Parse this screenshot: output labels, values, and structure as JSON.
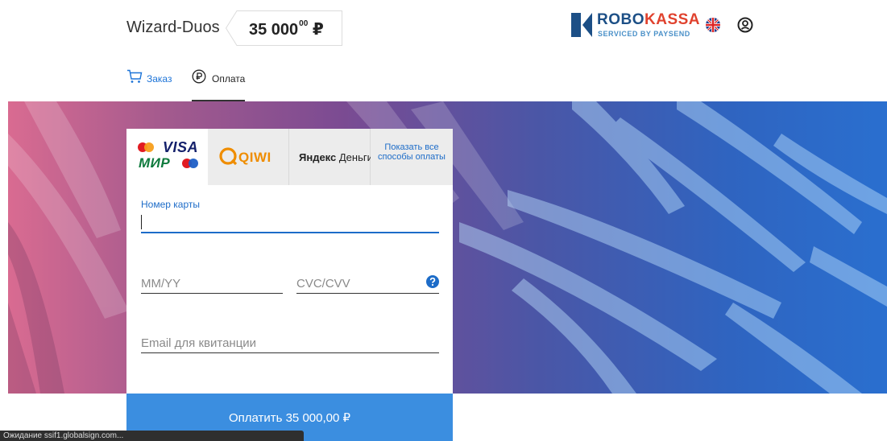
{
  "header": {
    "shop_name": "Wizard-Duos",
    "amount_main": "35 000",
    "amount_cents": "00",
    "currency": "₽",
    "logo_part1": "ROBO",
    "logo_part2": "KASSA",
    "logo_sub": "SERVICED BY PAYSEND",
    "language_icon": "uk-flag-icon",
    "account_icon": "user-circle-icon"
  },
  "nav": {
    "order_label": "Заказ",
    "payment_label": "Оплата",
    "active": "payment"
  },
  "methods": {
    "cards_visa": "VISA",
    "cards_mir": "МИР",
    "qiwi": "QIWI",
    "yandex_bold": "Яндекс",
    "yandex_rest": " Деньги",
    "show_all": "Показать все способы оплаты",
    "selected": "cards"
  },
  "form": {
    "card_label": "Номер карты",
    "card_value": "",
    "expiry_placeholder": "MM/YY",
    "cvc_placeholder": "CVC/CVV",
    "email_placeholder": "Email для квитанции"
  },
  "pay_button": "Оплатить 35 000,00 ₽",
  "status_bar": "Ожидание ssif1.globalsign.com...",
  "colors": {
    "accent": "#1d6cc8",
    "button": "#3b8ee0",
    "logo_blue": "#1c4f86",
    "logo_red": "#e0422e"
  }
}
